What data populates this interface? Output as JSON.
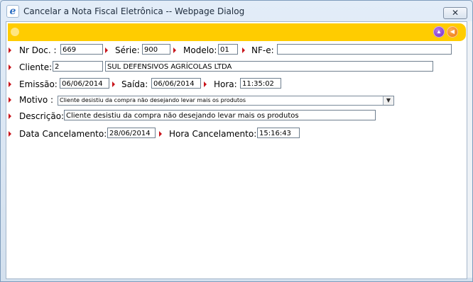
{
  "window": {
    "title": "Cancelar a Nota Fiscal Eletrônica -- Webpage Dialog",
    "browser_icon": "ie-icon",
    "close_label": "✕"
  },
  "toolbar": {
    "accent_color": "#ffcc00",
    "up_icon": "up-arrow-icon",
    "back_icon": "back-arrow-icon"
  },
  "form": {
    "nr_doc_label": "Nr Doc. :",
    "nr_doc_value": "669",
    "serie_label": "Série:",
    "serie_value": "900",
    "modelo_label": "Modelo:",
    "modelo_value": "01",
    "nfe_label": "NF-e:",
    "nfe_value": "",
    "cliente_label": "Cliente:",
    "cliente_code": "2",
    "cliente_name": "SUL DEFENSIVOS AGRÍCOLAS LTDA",
    "emissao_label": "Emissão:",
    "emissao_value": "06/06/2014",
    "saida_label": "Saída:",
    "saida_value": "06/06/2014",
    "hora_label": "Hora:",
    "hora_value": "11:35:02",
    "motivo_label": "Motivo :",
    "motivo_value": "Cliente desistiu da compra não desejando levar mais os produtos",
    "descricao_label": "Descrição:",
    "descricao_value": "Cliente desistiu da compra não desejando levar mais os produtos",
    "data_cancel_label": "Data Cancelamento:",
    "data_cancel_value": "28/06/2014",
    "hora_cancel_label": "Hora Cancelamento:",
    "hora_cancel_value": "15:16:43",
    "required_marker_color": "#c8141b"
  }
}
